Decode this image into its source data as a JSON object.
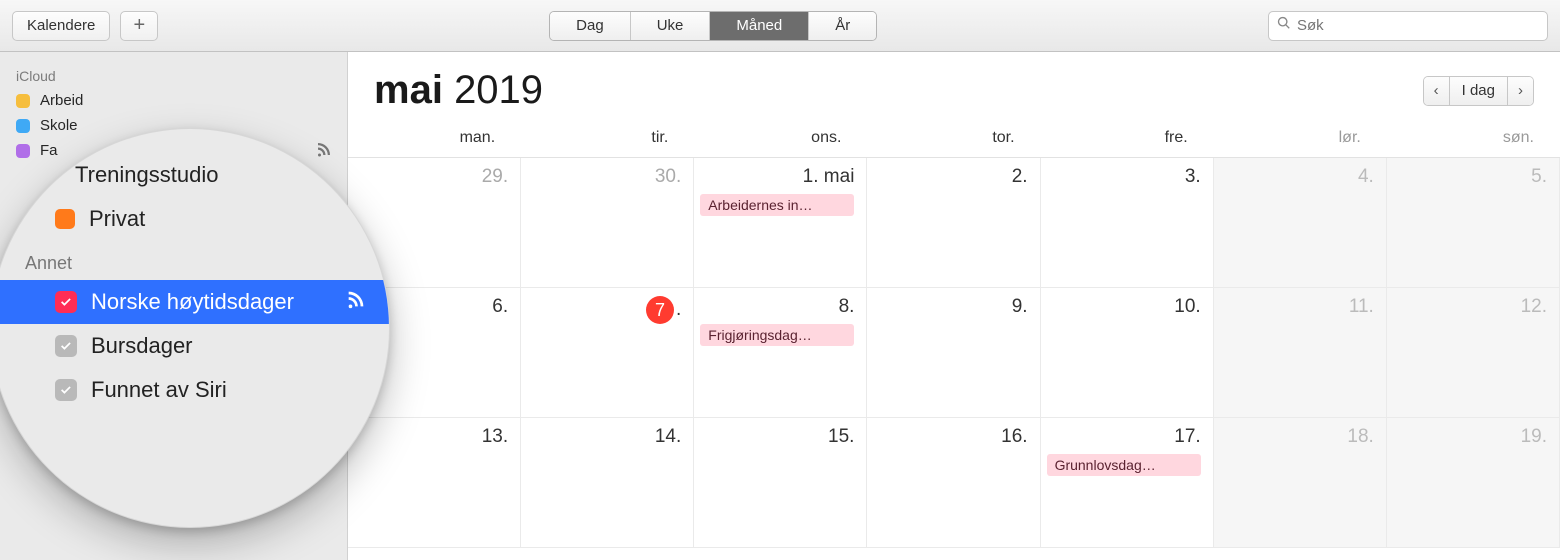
{
  "toolbar": {
    "calendars_label": "Kalendere",
    "view": {
      "day": "Dag",
      "week": "Uke",
      "month": "Måned",
      "year": "År"
    },
    "search_placeholder": "Søk"
  },
  "sidebar": {
    "groups": [
      {
        "label": "iCloud",
        "items": [
          {
            "label": "Arbeid",
            "color": "#f6be3d"
          },
          {
            "label": "Skole",
            "color": "#3fa9f5"
          },
          {
            "label": "Fa",
            "color": "#b06ee8",
            "shared": true
          }
        ]
      }
    ]
  },
  "zoom": {
    "top_items": [
      {
        "label": "Treningsstudio",
        "color": "#ff3b30",
        "shared": true
      },
      {
        "label": "Privat",
        "color": "#ff7a1a"
      }
    ],
    "group_label": "Annet",
    "items": [
      {
        "label": "Norske høytidsdager",
        "check_color": "pink",
        "selected": true,
        "shared": true
      },
      {
        "label": "Bursdager",
        "check_color": "grey"
      },
      {
        "label": "Funnet av Siri",
        "check_color": "grey"
      }
    ]
  },
  "month_header": {
    "month": "mai",
    "year": "2019",
    "today_label": "I dag"
  },
  "weekdays": [
    "man.",
    "tir.",
    "ons.",
    "tor.",
    "fre.",
    "lør.",
    "søn."
  ],
  "grid": [
    {
      "label": "29.",
      "dim": true
    },
    {
      "label": "30.",
      "dim": true
    },
    {
      "label": "1. mai",
      "events": [
        "Arbeidernes in…"
      ]
    },
    {
      "label": "2."
    },
    {
      "label": "3."
    },
    {
      "label": "4.",
      "weekend": true
    },
    {
      "label": "5.",
      "weekend": true
    },
    {
      "label": "6."
    },
    {
      "label": "7",
      "today": true,
      "trailing": "."
    },
    {
      "label": "8.",
      "events": [
        "Frigjøringsdag…"
      ]
    },
    {
      "label": "9."
    },
    {
      "label": "10."
    },
    {
      "label": "11.",
      "weekend": true
    },
    {
      "label": "12.",
      "weekend": true
    },
    {
      "label": "13."
    },
    {
      "label": "14."
    },
    {
      "label": "15."
    },
    {
      "label": "16."
    },
    {
      "label": "17.",
      "events": [
        "Grunnlovsdag…"
      ]
    },
    {
      "label": "18.",
      "weekend": true
    },
    {
      "label": "19.",
      "weekend": true
    }
  ]
}
